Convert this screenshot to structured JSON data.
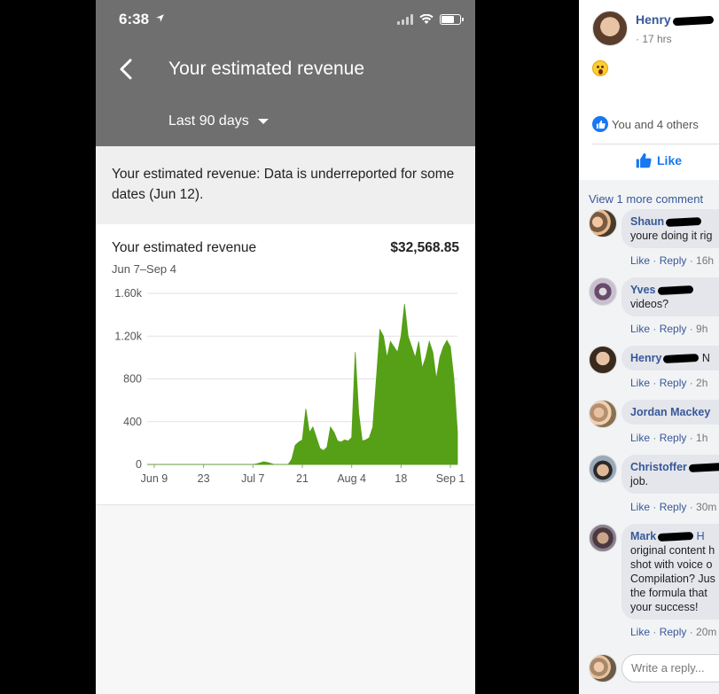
{
  "phone": {
    "status_time": "6:38",
    "title": "Your estimated revenue",
    "period": "Last 90 days",
    "notice": "Your estimated revenue: Data is underreported for some dates (Jun 12).",
    "card_title": "Your estimated revenue",
    "card_total": "$32,568.85",
    "card_range": "Jun 7–Sep 4",
    "accent": "#55a016"
  },
  "chart_data": {
    "type": "area",
    "title": "",
    "xlabel": "",
    "ylabel": "",
    "ylim": [
      0,
      1600
    ],
    "yticks": [
      "1.60k",
      "1.20k",
      "800",
      "400",
      "0"
    ],
    "ytick_values": [
      1600,
      1200,
      800,
      400,
      0
    ],
    "xticks": [
      "Jun 9",
      "23",
      "Jul 7",
      "21",
      "Aug 4",
      "18",
      "Sep 1"
    ],
    "xtick_days": [
      2,
      16,
      30,
      44,
      58,
      72,
      86
    ],
    "x_start": "Jun 7",
    "grid": true,
    "series": [
      {
        "color": "#55a016",
        "values": [
          0,
          0,
          0,
          0,
          0,
          0,
          0,
          0,
          0,
          0,
          0,
          0,
          0,
          0,
          0,
          0,
          0,
          0,
          0,
          0,
          0,
          0,
          0,
          0,
          0,
          0,
          0,
          0,
          0,
          0,
          0,
          5,
          15,
          25,
          20,
          10,
          0,
          0,
          0,
          0,
          0,
          50,
          180,
          210,
          230,
          520,
          300,
          350,
          250,
          150,
          130,
          160,
          350,
          300,
          220,
          210,
          230,
          220,
          250,
          1050,
          480,
          220,
          230,
          250,
          350,
          800,
          1260,
          1200,
          1000,
          1150,
          1100,
          1050,
          1200,
          1500,
          1200,
          1100,
          1000,
          1150,
          900,
          1000,
          1150,
          1050,
          800,
          1000,
          1100,
          1160,
          1100,
          800,
          300
        ]
      }
    ]
  },
  "fb": {
    "post_author": "Henry",
    "post_time": "· 17 hrs",
    "likes_text": "You and 4 others",
    "like_label": "Like",
    "more_comments": "View 1 more comment",
    "reply_placeholder": "Write a reply...",
    "comments": [
      {
        "name": "Shaun",
        "lines": [
          "youre doing it rig"
        ],
        "time": "16h"
      },
      {
        "name": "Yves",
        "lines": [
          "videos?"
        ],
        "time": "9h"
      },
      {
        "name": "Henry",
        "lines": [],
        "name_suffix": "N",
        "time": "2h"
      },
      {
        "name": "Jordan Mackey",
        "lines": [],
        "time": "1h"
      },
      {
        "name": "Christoffer",
        "lines": [
          "job."
        ],
        "time": "30m"
      },
      {
        "name": "Mark",
        "name_suffix": "H",
        "lines": [
          "original content h",
          "shot with voice o",
          "Compilation? Jus",
          "the formula that",
          "your success!"
        ],
        "time": "20m"
      }
    ],
    "action_like": "Like",
    "action_reply": "Reply",
    "sep": "·"
  }
}
